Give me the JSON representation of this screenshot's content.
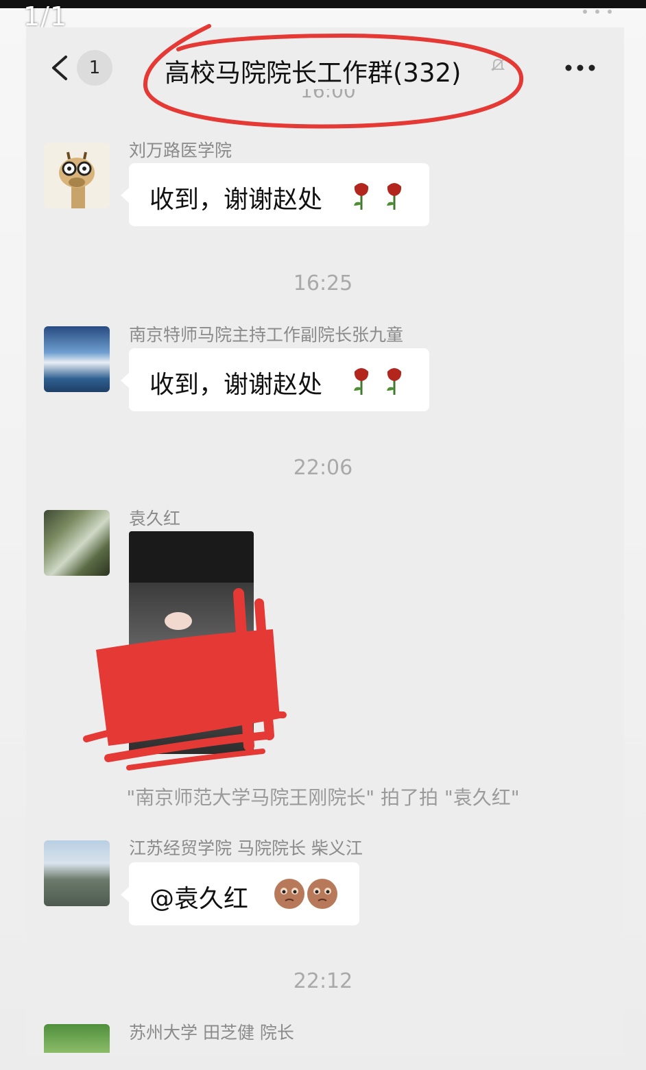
{
  "viewer": {
    "page_counter": "1/1"
  },
  "header": {
    "unread_count": "1",
    "title": "高校马院院长工作群(332)"
  },
  "messages": [
    {
      "sender": "刘万路医学院",
      "text": "收到，谢谢赵处",
      "emoji": [
        "rose-icon",
        "rose-icon"
      ]
    },
    {
      "timestamp": "16:25",
      "sender": "南京特师马院主持工作副院长张九童",
      "text": "收到，谢谢赵处",
      "emoji": [
        "rose-icon",
        "rose-icon"
      ]
    },
    {
      "timestamp": "22:06",
      "sender": "袁久红",
      "type": "video"
    },
    {
      "system": "\"南京师范大学马院王刚院长\" 拍了拍 \"袁久红\""
    },
    {
      "sender": "江苏经贸学院 马院院长  柴义江",
      "text": "@袁久红",
      "emoji": [
        "cry-face-icon",
        "cry-face-icon"
      ]
    },
    {
      "timestamp": "22:12",
      "sender": "苏州大学 田芝健 院长"
    }
  ],
  "colors": {
    "annotation_red": "#e53935",
    "chat_background": "#ededed",
    "bubble": "#ffffff"
  }
}
